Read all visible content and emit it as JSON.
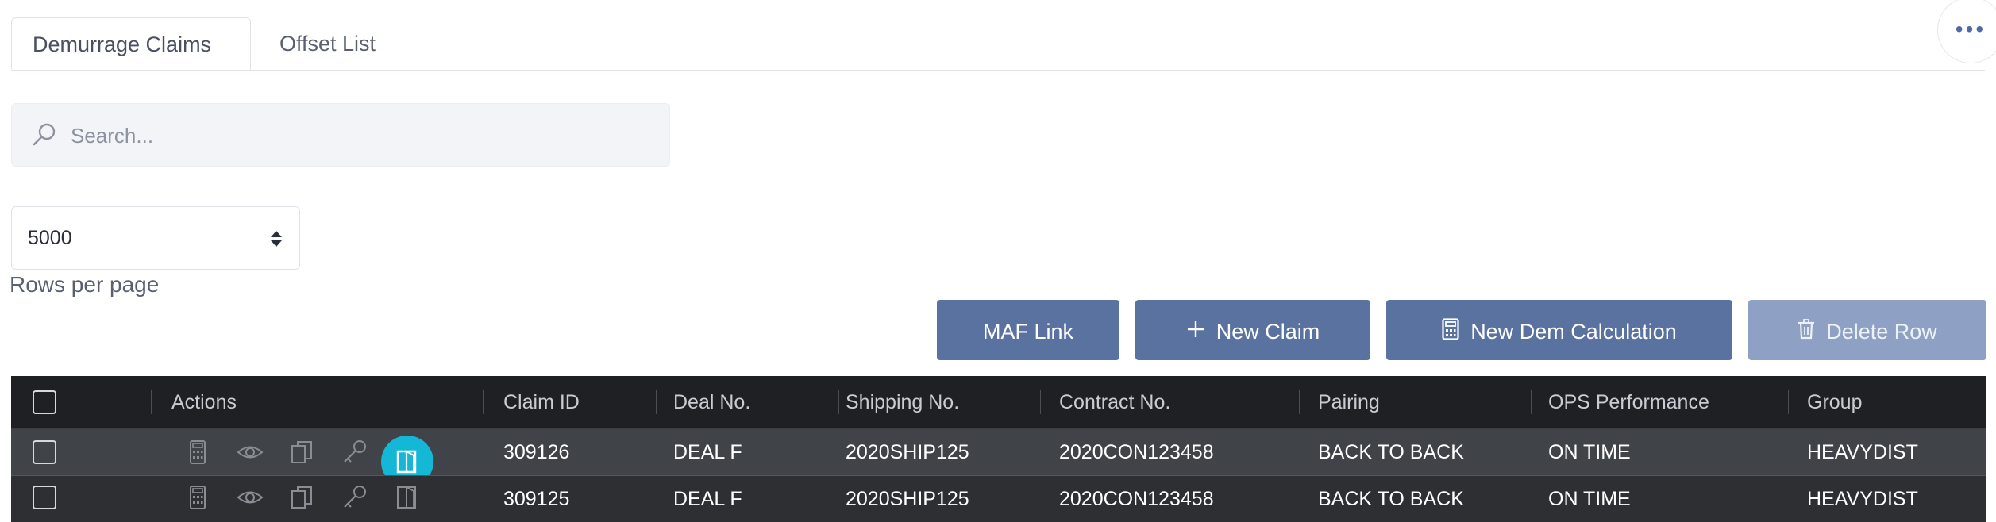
{
  "tabs": [
    {
      "label": "Demurrage Claims",
      "active": true
    },
    {
      "label": "Offset List",
      "active": false
    }
  ],
  "search": {
    "placeholder": "Search..."
  },
  "pagination": {
    "rows_per_page_value": "5000",
    "rows_per_page_label": "Rows per page"
  },
  "toolbar": {
    "maf_link": "MAF Link",
    "new_claim": "New Claim",
    "new_dem_calc": "New Dem Calculation",
    "delete_row": "Delete Row"
  },
  "table": {
    "columns": [
      "Actions",
      "Claim ID",
      "Deal No.",
      "Shipping No.",
      "Contract No.",
      "Pairing",
      "OPS Performance",
      "Group"
    ],
    "rows": [
      {
        "claim_id": "309126",
        "deal_no": "DEAL F",
        "shipping_no": "2020SHIP125",
        "contract_no": "2020CON123458",
        "pairing": "BACK TO BACK",
        "ops": "ON TIME",
        "group": "HEAVYDIST"
      },
      {
        "claim_id": "309125",
        "deal_no": "DEAL F",
        "shipping_no": "2020SHIP125",
        "contract_no": "2020CON123458",
        "pairing": "BACK TO BACK",
        "ops": "ON TIME",
        "group": "HEAVYDIST"
      }
    ],
    "row_action_icons": [
      "calculator-icon",
      "eye-icon",
      "copy-icon",
      "key-icon",
      "book-icon"
    ]
  },
  "colors": {
    "button": "#5a72a0",
    "button_disabled": "#8ea0c3",
    "table_header": "#1f2023",
    "row_highlight": "#404347",
    "action_highlight": "#14b8d6"
  }
}
